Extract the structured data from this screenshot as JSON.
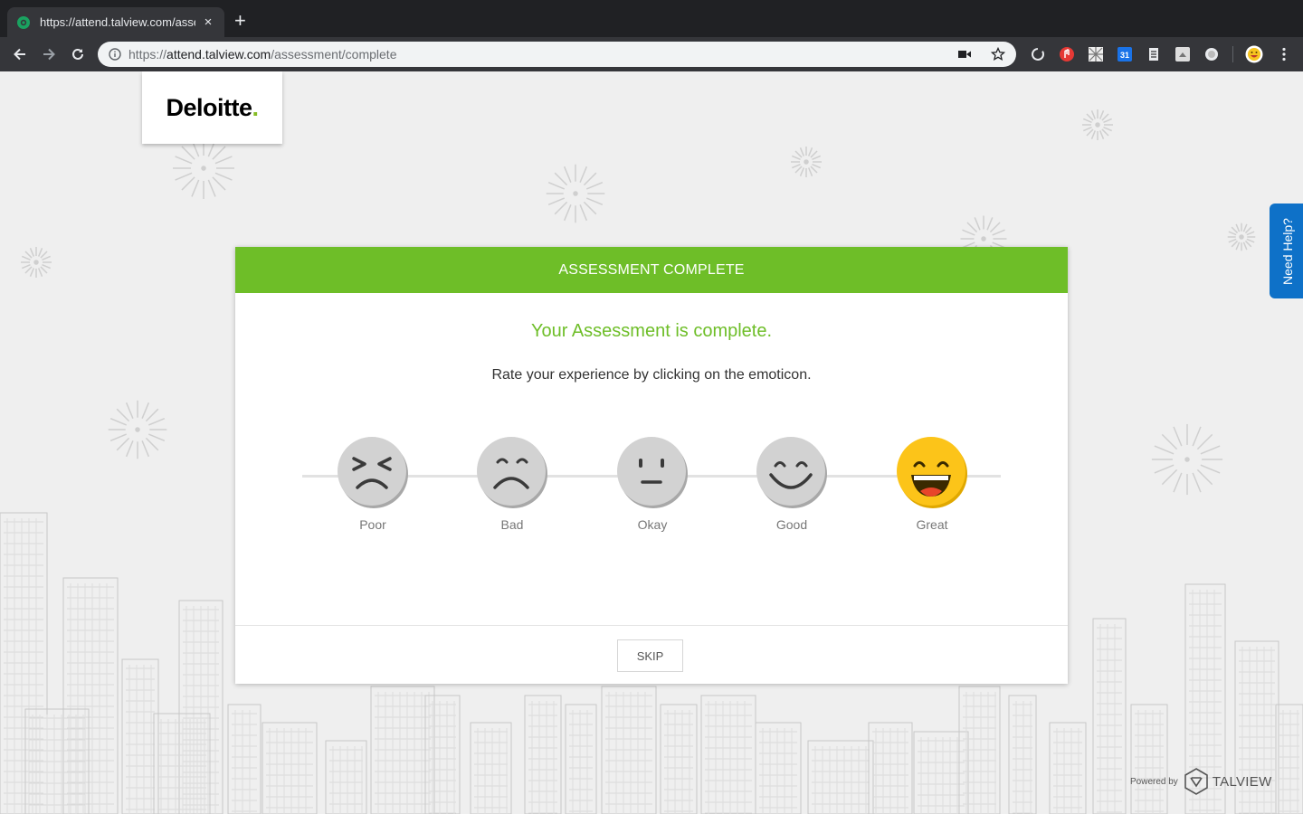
{
  "browser": {
    "tab_title": "https://attend.talview.com/assessment/complete",
    "tab_close": "×",
    "new_tab": "+",
    "url_prefix": "https://",
    "url_host": "attend.talview.com",
    "url_path": "/assessment/complete"
  },
  "page": {
    "logo": {
      "text": "Deloitte",
      "dot": "."
    },
    "need_help": "Need Help?",
    "card": {
      "header": "ASSESSMENT COMPLETE",
      "headline": "Your Assessment is complete.",
      "subline": "Rate your experience by clicking on the emoticon.",
      "ratings": [
        {
          "label": "Poor"
        },
        {
          "label": "Bad"
        },
        {
          "label": "Okay"
        },
        {
          "label": "Good"
        },
        {
          "label": "Great",
          "selected": true
        }
      ],
      "skip": "SKIP"
    },
    "footer": {
      "powered_by": "Powered by",
      "brand": "TALVIEW"
    }
  },
  "colors": {
    "accent_green": "#6ebe28",
    "help_blue": "#0e71c8",
    "selected_face": "#f7c41f",
    "neutral_face": "#d0d0d0"
  }
}
